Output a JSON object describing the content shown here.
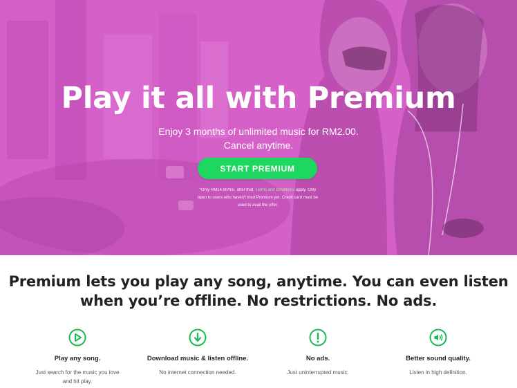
{
  "hero": {
    "title": "Play it all with Premium",
    "subtitle_line1": "Enjoy 3 months of unlimited music for RM2.00.",
    "subtitle_line2": "Cancel anytime.",
    "cta_label": "START PREMIUM",
    "fine_print_before": "*Only RM14.90/mo. after that.",
    "fine_print_link": "Terms and conditions",
    "fine_print_after": "apply. Only open to users who haven't tried Premium yet. Credit card must be used to avail the offer."
  },
  "tagline": {
    "line1": "Premium lets you play any song, anytime. You can even listen",
    "line2": "when you’re offline. No restrictions. No ads."
  },
  "features": [
    {
      "icon": "play-icon",
      "title": "Play any song.",
      "desc_line1": "Just search for the music you love",
      "desc_line2": "and hit play."
    },
    {
      "icon": "download-icon",
      "title": "Download music & listen offline.",
      "desc_line1": "No internet connection needed.",
      "desc_line2": ""
    },
    {
      "icon": "exclamation-icon",
      "title": "No ads.",
      "desc_line1": "Just uninterrupted music.",
      "desc_line2": ""
    },
    {
      "icon": "speaker-icon",
      "title": "Better sound quality.",
      "desc_line1": "Listen in high definition.",
      "desc_line2": ""
    }
  ],
  "colors": {
    "hero_overlay": "#d65ec9",
    "cta_green": "#1ed760",
    "icon_green": "#1db954"
  }
}
